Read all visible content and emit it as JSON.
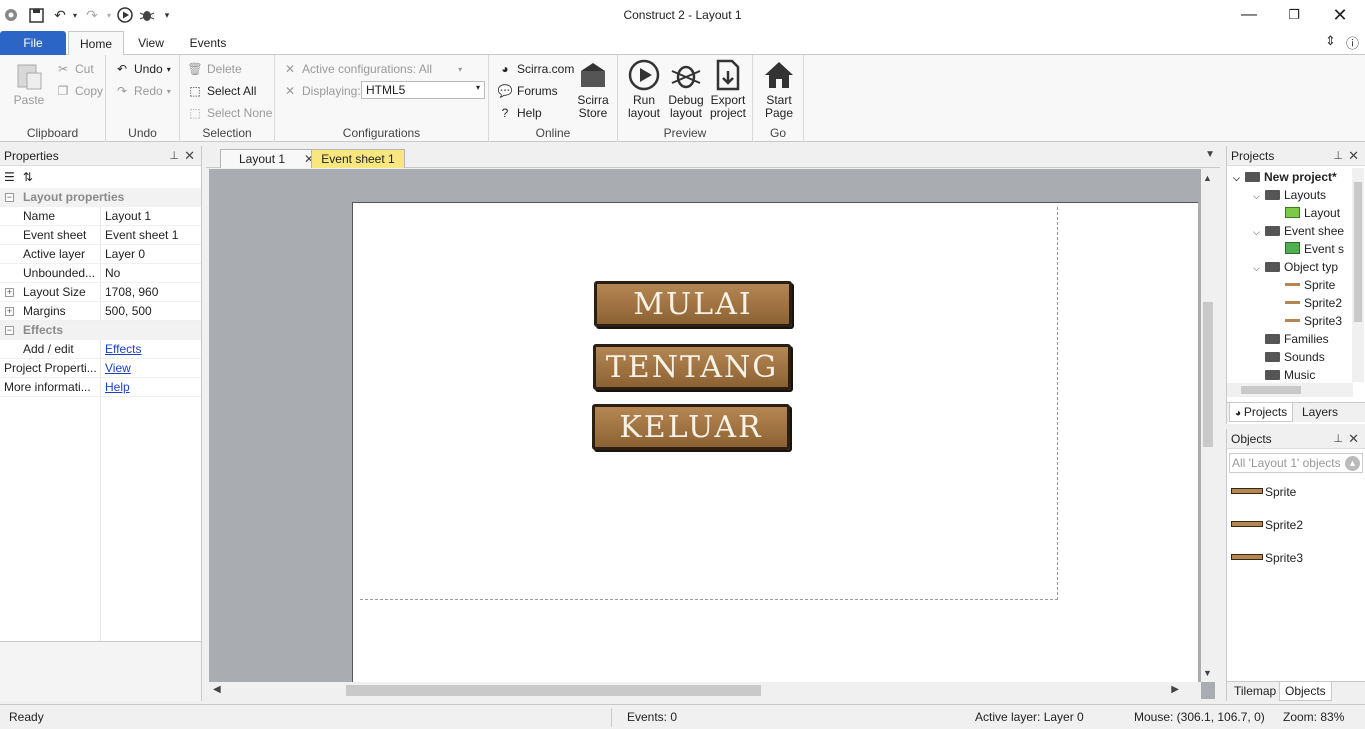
{
  "window": {
    "title": "Construct 2 - Layout 1"
  },
  "quick_access": [
    "app-icon",
    "save-icon",
    "undo-icon",
    "redo-icon",
    "run-icon",
    "debug-icon",
    "customize-icon"
  ],
  "ribbon": {
    "tabs": {
      "file": "File",
      "home": "Home",
      "view": "View",
      "events": "Events"
    },
    "clipboard": {
      "paste": "Paste",
      "cut": "Cut",
      "copy": "Copy",
      "label": "Clipboard"
    },
    "undo": {
      "undo": "Undo",
      "redo": "Redo",
      "label": "Undo"
    },
    "selection": {
      "delete": "Delete",
      "select_all": "Select All",
      "select_none": "Select None",
      "label": "Selection"
    },
    "configurations": {
      "active": "Active configurations: All",
      "displaying": "Displaying:",
      "displaying_value": "HTML5",
      "label": "Configurations"
    },
    "online": {
      "scirra": "Scirra.com",
      "forums": "Forums",
      "help": "Help",
      "store_l1": "Scirra",
      "store_l2": "Store",
      "label": "Online"
    },
    "preview": {
      "run_l1": "Run",
      "run_l2": "layout",
      "debug_l1": "Debug",
      "debug_l2": "layout",
      "export_l1": "Export",
      "export_l2": "project",
      "label": "Preview"
    },
    "go": {
      "start_l1": "Start",
      "start_l2": "Page",
      "label": "Go"
    }
  },
  "properties": {
    "title": "Properties",
    "rows": {
      "layout_props": "Layout properties",
      "name_k": "Name",
      "name_v": "Layout 1",
      "evsheet_k": "Event sheet",
      "evsheet_v": "Event sheet 1",
      "active_k": "Active layer",
      "active_v": "Layer 0",
      "unbounded_k": "Unbounded...",
      "unbounded_v": "No",
      "size_k": "Layout Size",
      "size_v": "1708, 960",
      "margins_k": "Margins",
      "margins_v": "500, 500",
      "effects": "Effects",
      "addedit_k": "Add / edit",
      "addedit_v": "Effects",
      "projprops_k": "Project Properti...",
      "projprops_v": "View",
      "moreinfo_k": "More informati...",
      "moreinfo_v": "Help"
    }
  },
  "doc_tabs": {
    "layout": "Layout 1",
    "events": "Event sheet 1"
  },
  "canvas": {
    "buttons": [
      "MULAI",
      "TENTANG",
      "KELUAR"
    ]
  },
  "projects": {
    "title": "Projects",
    "tree": {
      "root": "New project*",
      "layouts": "Layouts",
      "layout1": "Layout",
      "eventsheets": "Event shee",
      "eventsheet1": "Event s",
      "objecttypes": "Object typ",
      "sprite": "Sprite",
      "sprite2": "Sprite2",
      "sprite3": "Sprite3",
      "families": "Families",
      "sounds": "Sounds",
      "music": "Music"
    },
    "tabs": {
      "projects": "Projects",
      "layers": "Layers"
    }
  },
  "objects": {
    "title": "Objects",
    "filter": "All 'Layout 1' objects",
    "items": [
      "Sprite",
      "Sprite2",
      "Sprite3"
    ],
    "tabs": {
      "tilemap": "Tilemap",
      "objects": "Objects"
    }
  },
  "statusbar": {
    "ready": "Ready",
    "events": "Events: 0",
    "active_layer": "Active layer: Layer 0",
    "mouse": "Mouse: (306.1, 106.7, 0)",
    "zoom": "Zoom: 83%"
  }
}
